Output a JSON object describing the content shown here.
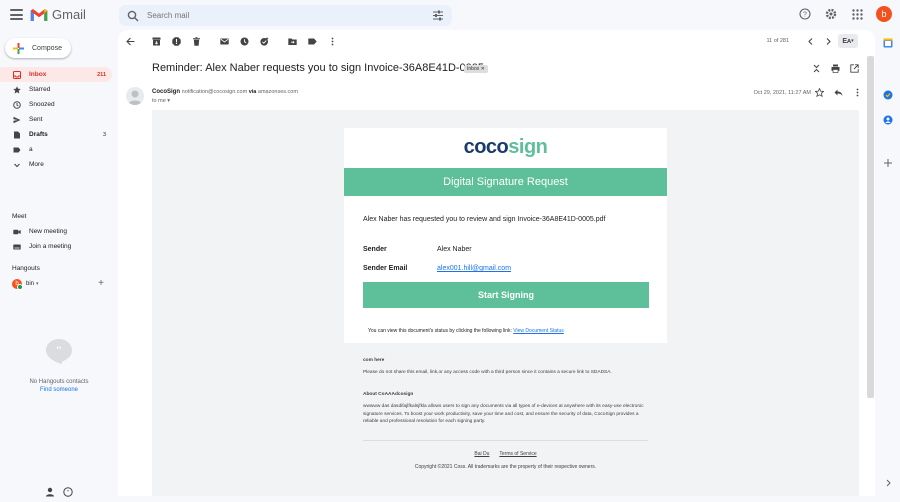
{
  "app": {
    "name": "Gmail",
    "avatar_letter": "b"
  },
  "search": {
    "placeholder": "Search mail"
  },
  "compose": {
    "label": "Compose"
  },
  "nav": [
    {
      "label": "Inbox",
      "count": "211",
      "icon": "inbox-icon",
      "active": true
    },
    {
      "label": "Starred",
      "count": "",
      "icon": "star-icon"
    },
    {
      "label": "Snoozed",
      "count": "",
      "icon": "clock-icon"
    },
    {
      "label": "Sent",
      "count": "",
      "icon": "send-icon"
    },
    {
      "label": "Drafts",
      "count": "3",
      "icon": "draft-icon"
    },
    {
      "label": "a",
      "count": "",
      "icon": "label-icon"
    },
    {
      "label": "More",
      "count": "",
      "icon": "chevron-down-icon"
    }
  ],
  "meet": {
    "title": "Meet",
    "new_meeting": "New meeting",
    "join": "Join a meeting"
  },
  "hangouts": {
    "title": "Hangouts",
    "user": "bin",
    "user_letter": "b",
    "empty_text": "No Hangouts contacts",
    "find_link": "Find someone"
  },
  "toolbar": {
    "pager": "11 of 281"
  },
  "message": {
    "subject": "Reminder: Alex Naber requests you to sign Invoice-36A8E41D-0005",
    "badge": "Inbox",
    "sender_name": "CocoSign",
    "sender_email": "notification@cocosign.com",
    "via": "via",
    "via_domain": "amazonses.com",
    "to": "to me",
    "date": "Oct 29, 2021, 11:27 AM"
  },
  "email": {
    "brand_a": "coco",
    "brand_b": "sign",
    "banner": "Digital Signature Request",
    "request_text": "Alex Naber has requested you to review and sign Invoice-36A8E41D-0005.pdf",
    "sender_label": "Sender",
    "sender_value": "Alex Naber",
    "email_label": "Sender Email",
    "email_value": "alex001.hill@gmail.com",
    "button": "Start Signing",
    "status_text": "You can view this document's status by clicking the following link:",
    "status_link": "View Document Status",
    "footer_title1": "com here",
    "footer_text1": "Please do not share this email, link,or any access code with a third person since it contains a secure link to SDADSA.",
    "footer_title2": "About CoAAAdcosign",
    "footer_text2": "wwwww das dasdifajlfkalsjfkla allows users to sign any documents via all types of e-devices at anywhere with its easy-use electronic signature services. To boost your work productivity, save your time and cost, and ensure the security of data, CocoSign provides a reliable and professional resolution for each signing party.",
    "link1": "Bai Du",
    "link2": "Terms of Service",
    "copyright": "Copyright ©2021 Coss. All trademarks are the property of their respective owners."
  },
  "colors": {
    "accent_red": "#d93025",
    "brand_green": "#5ec09a",
    "brand_navy": "#1a3c6e",
    "link_blue": "#1a73e8"
  }
}
